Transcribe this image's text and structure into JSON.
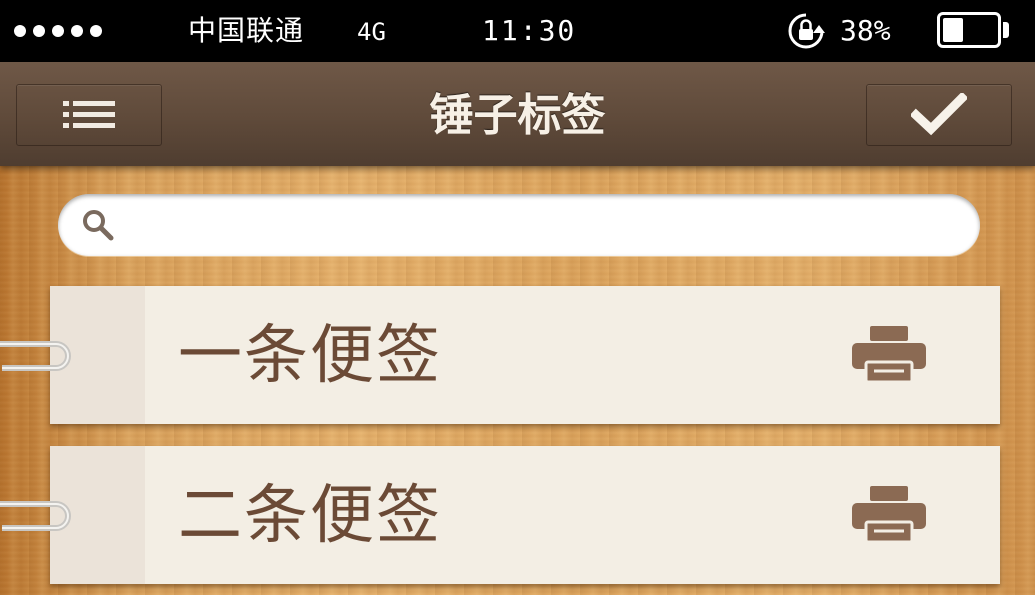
{
  "status_bar": {
    "carrier": "中国联通",
    "network": "4G",
    "time": "11:30",
    "battery_percent": "38%",
    "battery_level": 0.38,
    "signal_dots": 5,
    "icons": [
      "signal-dots-icon",
      "rotation-lock-icon",
      "battery-icon"
    ]
  },
  "nav": {
    "title": "锤子标签",
    "left_button_icon": "menu-icon",
    "right_button_icon": "checkmark-icon"
  },
  "search": {
    "value": "",
    "placeholder": "",
    "icon": "search-icon"
  },
  "notes": [
    {
      "title": "一条便签",
      "action_icon": "printer-icon"
    },
    {
      "title": "二条便签",
      "action_icon": "printer-icon"
    }
  ],
  "colors": {
    "nav_bar": "#5f4a3a",
    "wood": "#dca35c",
    "card": "#f3eee4",
    "note_text": "#6b4a36",
    "printer": "#8b6a53"
  }
}
